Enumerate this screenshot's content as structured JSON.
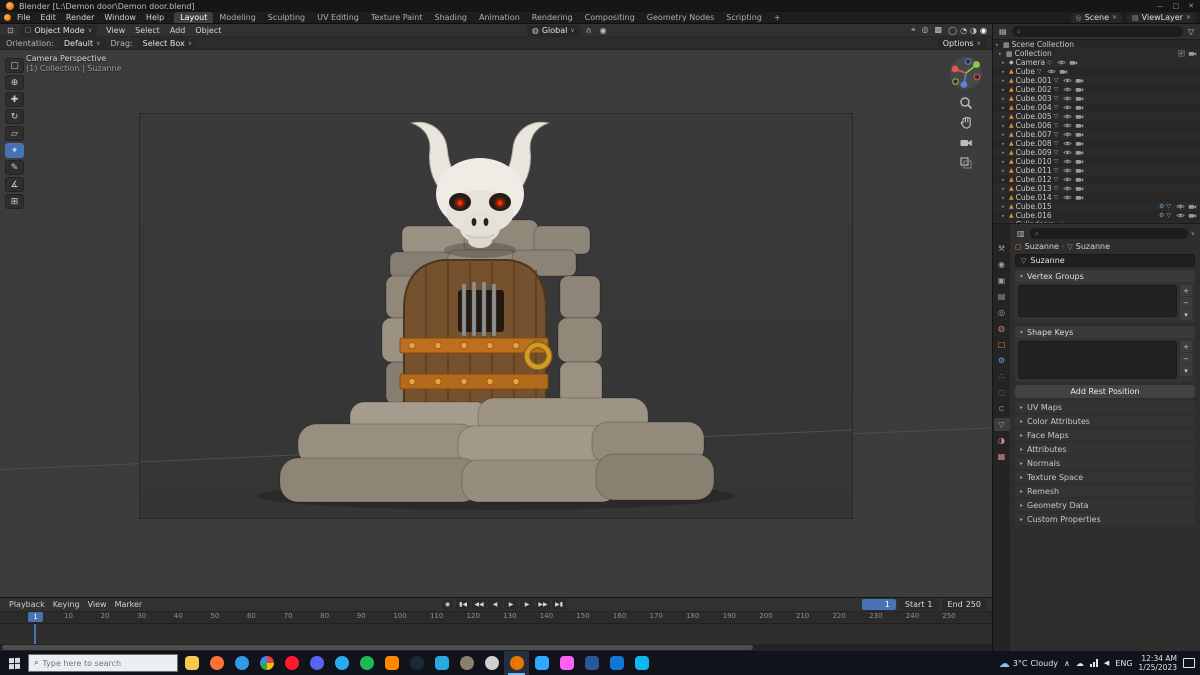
{
  "window": {
    "title": "Blender [L:\\Demon door\\Demon door.blend]",
    "controls": {
      "minimize": "—",
      "maximize": "□",
      "close": "✕"
    }
  },
  "topbar": {
    "menus": [
      "File",
      "Edit",
      "Render",
      "Window",
      "Help"
    ],
    "workspaces": [
      {
        "label": "Layout",
        "state": "active"
      },
      {
        "label": "Modeling",
        "state": ""
      },
      {
        "label": "Sculpting",
        "state": ""
      },
      {
        "label": "UV Editing",
        "state": ""
      },
      {
        "label": "Texture Paint",
        "state": ""
      },
      {
        "label": "Shading",
        "state": ""
      },
      {
        "label": "Animation",
        "state": ""
      },
      {
        "label": "Rendering",
        "state": ""
      },
      {
        "label": "Compositing",
        "state": ""
      },
      {
        "label": "Geometry Nodes",
        "state": ""
      },
      {
        "label": "Scripting",
        "state": ""
      }
    ],
    "add_workspace": "+",
    "scene_label": "Scene",
    "viewlayer_label": "ViewLayer"
  },
  "viewport": {
    "header": {
      "mode": "Object Mode",
      "menus": [
        "View",
        "Select",
        "Add",
        "Object"
      ],
      "orientation": "Global",
      "snap_icon": "∩",
      "proportional_icon": "◉",
      "right_icons": [
        {
          "name": "show-gizmo-icon",
          "glyph": "⌖"
        },
        {
          "name": "show-overlays-icon",
          "glyph": "◎"
        },
        {
          "name": "toggle-xray-icon",
          "glyph": "▩"
        }
      ],
      "shading_modes": [
        {
          "name": "shading-wireframe-icon",
          "glyph": "◯",
          "state": ""
        },
        {
          "name": "shading-solid-icon",
          "glyph": "◔",
          "state": ""
        },
        {
          "name": "shading-material-icon",
          "glyph": "◑",
          "state": ""
        },
        {
          "name": "shading-rendered-icon",
          "glyph": "◉",
          "state": "on"
        }
      ]
    },
    "tool_settings": {
      "orientation_label": "Orientation:",
      "orientation_value": "Default",
      "drag_label": "Drag:",
      "tool_value": "Select Box",
      "options_label": "Options"
    },
    "tools": [
      {
        "name": "tool-tweak-select",
        "glyph": "▢",
        "state": ""
      },
      {
        "name": "tool-cursor",
        "glyph": "⊕",
        "state": ""
      },
      {
        "name": "tool-move",
        "glyph": "✚",
        "state": ""
      },
      {
        "name": "tool-rotate",
        "glyph": "↻",
        "state": ""
      },
      {
        "name": "tool-scale",
        "glyph": "▱",
        "state": ""
      },
      {
        "name": "tool-transform",
        "glyph": "⌖",
        "state": "active"
      },
      {
        "name": "tool-annotate",
        "glyph": "✎",
        "state": ""
      },
      {
        "name": "tool-measure",
        "glyph": "∡",
        "state": ""
      },
      {
        "name": "tool-add-cube",
        "glyph": "⊞",
        "state": ""
      }
    ],
    "overlay": {
      "line1": "Camera Perspective",
      "line2": "(1) Collection | Suzanne"
    }
  },
  "outliner": {
    "caret": "▸",
    "root": "Scene Collection",
    "collection": "Collection",
    "items": [
      {
        "dname": "outliner-item-camera",
        "name": "Camera",
        "icon": "◆",
        "cls": "ico-cam",
        "data_icon": "◇",
        "extra": ""
      },
      {
        "dname": "outliner-item-cube",
        "name": "Cube",
        "icon": "▲",
        "cls": "ico-mesh",
        "data_icon": "▽",
        "extra": ""
      },
      {
        "dname": "outliner-item-cube-001",
        "name": "Cube.001",
        "icon": "▲",
        "cls": "ico-mesh",
        "data_icon": "▽",
        "extra": ""
      },
      {
        "dname": "outliner-item-cube-002",
        "name": "Cube.002",
        "icon": "▲",
        "cls": "ico-mesh",
        "data_icon": "▽",
        "extra": ""
      },
      {
        "dname": "outliner-item-cube-003",
        "name": "Cube.003",
        "icon": "▲",
        "cls": "ico-mesh",
        "data_icon": "▽",
        "extra": ""
      },
      {
        "dname": "outliner-item-cube-004",
        "name": "Cube.004",
        "icon": "▲",
        "cls": "ico-mesh",
        "data_icon": "▽",
        "extra": ""
      },
      {
        "dname": "outliner-item-cube-005",
        "name": "Cube.005",
        "icon": "▲",
        "cls": "ico-mesh",
        "data_icon": "▽",
        "extra": ""
      },
      {
        "dname": "outliner-item-cube-006",
        "name": "Cube.006",
        "icon": "▲",
        "cls": "ico-mesh",
        "data_icon": "▽",
        "extra": ""
      },
      {
        "dname": "outliner-item-cube-007",
        "name": "Cube.007",
        "icon": "▲",
        "cls": "ico-mesh",
        "data_icon": "▽",
        "extra": ""
      },
      {
        "dname": "outliner-item-cube-008",
        "name": "Cube.008",
        "icon": "▲",
        "cls": "ico-mesh",
        "data_icon": "▽",
        "extra": ""
      },
      {
        "dname": "outliner-item-cube-009",
        "name": "Cube.009",
        "icon": "▲",
        "cls": "ico-mesh",
        "data_icon": "▽",
        "extra": ""
      },
      {
        "dname": "outliner-item-cube-010",
        "name": "Cube.010",
        "icon": "▲",
        "cls": "ico-mesh",
        "data_icon": "▽",
        "extra": ""
      },
      {
        "dname": "outliner-item-cube-011",
        "name": "Cube.011",
        "icon": "▲",
        "cls": "ico-mesh",
        "data_icon": "▽",
        "extra": ""
      },
      {
        "dname": "outliner-item-cube-012",
        "name": "Cube.012",
        "icon": "▲",
        "cls": "ico-mesh",
        "data_icon": "▽",
        "extra": ""
      },
      {
        "dname": "outliner-item-cube-013",
        "name": "Cube.013",
        "icon": "▲",
        "cls": "ico-mesh",
        "data_icon": "▽",
        "extra": ""
      },
      {
        "dname": "outliner-item-cube-014",
        "name": "Cube.014",
        "icon": "▲",
        "cls": "ico-mesh",
        "data_icon": "▽",
        "extra": ""
      },
      {
        "dname": "outliner-item-cube-015",
        "name": "Cube.015",
        "icon": "▲",
        "cls": "ico-mesh",
        "data_icon": "▽",
        "extra": "⚙"
      },
      {
        "dname": "outliner-item-cube-016",
        "name": "Cube.016",
        "icon": "▲",
        "cls": "ico-mesh",
        "data_icon": "▽",
        "extra": "⚙"
      },
      {
        "dname": "outliner-item-cylinder",
        "name": "Cylinder",
        "icon": "▲",
        "cls": "ico-mesh",
        "data_icon": "▽",
        "extra": ""
      }
    ]
  },
  "properties": {
    "tabs": [
      {
        "name": "tab-tool-properties",
        "glyph": "⚒",
        "cls": "t-gray",
        "state": ""
      },
      {
        "name": "tab-render-properties",
        "glyph": "◉",
        "cls": "t-gray",
        "state": ""
      },
      {
        "name": "tab-output-properties",
        "glyph": "▣",
        "cls": "t-gray",
        "state": ""
      },
      {
        "name": "tab-view-layer-properties",
        "glyph": "▤",
        "cls": "t-gray",
        "state": ""
      },
      {
        "name": "tab-scene-properties",
        "glyph": "◎",
        "cls": "t-gray",
        "state": ""
      },
      {
        "name": "tab-world-properties",
        "glyph": "◍",
        "cls": "t-red",
        "state": ""
      },
      {
        "name": "tab-object-properties",
        "glyph": "□",
        "cls": "t-orange",
        "state": ""
      },
      {
        "name": "tab-modifier-properties",
        "glyph": "⚙",
        "cls": "t-blue",
        "state": ""
      },
      {
        "name": "tab-particle-properties",
        "glyph": "∴",
        "cls": "t-blue",
        "state": ""
      },
      {
        "name": "tab-physics-properties",
        "glyph": "◌",
        "cls": "t-blue",
        "state": ""
      },
      {
        "name": "tab-constraint-properties",
        "glyph": "⊂",
        "cls": "t-blue",
        "state": ""
      },
      {
        "name": "tab-object-data-properties",
        "glyph": "▽",
        "cls": "t-green",
        "state": "active"
      },
      {
        "name": "tab-material-properties",
        "glyph": "◑",
        "cls": "t-pink",
        "state": ""
      },
      {
        "name": "tab-texture-properties",
        "glyph": "▦",
        "cls": "t-pink",
        "state": ""
      }
    ],
    "breadcrumb": {
      "object": "Suzanne",
      "data": "Suzanne",
      "sep": "›"
    },
    "name_field": "Suzanne",
    "vertex_groups_label": "Vertex Groups",
    "shape_keys_label": "Shape Keys",
    "rest_button": "Add Rest Position",
    "list_buttons": {
      "add": "+",
      "remove": "−",
      "menu": "▾"
    },
    "collapsed_panels": [
      {
        "label": "UV Maps"
      },
      {
        "label": "Color Attributes"
      },
      {
        "label": "Face Maps"
      },
      {
        "label": "Attributes"
      },
      {
        "label": "Normals"
      },
      {
        "label": "Texture Space"
      },
      {
        "label": "Remesh"
      },
      {
        "label": "Geometry Data"
      },
      {
        "label": "Custom Properties"
      }
    ]
  },
  "timeline": {
    "menus": [
      "Playback",
      "Keying",
      "View",
      "Marker"
    ],
    "autokey_icon": "◉",
    "transport": [
      {
        "name": "jump-to-start-button",
        "glyph": "▮◀"
      },
      {
        "name": "prev-keyframe-button",
        "glyph": "◀◀"
      },
      {
        "name": "prev-frame-button",
        "glyph": "◀"
      },
      {
        "name": "play-button",
        "glyph": "▶"
      },
      {
        "name": "next-frame-button",
        "glyph": "▶"
      },
      {
        "name": "next-keyframe-button",
        "glyph": "▶▶"
      },
      {
        "name": "jump-to-end-button",
        "glyph": "▶▮"
      }
    ],
    "current_frame": "1",
    "start_label": "Start",
    "start_value": "1",
    "end_label": "End",
    "end_value": "250",
    "ruler": [
      "10",
      "20",
      "30",
      "40",
      "50",
      "60",
      "70",
      "80",
      "90",
      "100",
      "110",
      "120",
      "130",
      "140",
      "150",
      "160",
      "170",
      "180",
      "190",
      "200",
      "210",
      "220",
      "230",
      "240",
      "250"
    ]
  },
  "taskbar": {
    "search_placeholder": "Type here to search",
    "apps": [
      {
        "name": "taskbar-app-file-explorer",
        "style": "background:#f6c84c",
        "state": ""
      },
      {
        "name": "taskbar-app-firefox",
        "style": "background:#ff7139;border-radius:50%",
        "state": ""
      },
      {
        "name": "taskbar-app-edge",
        "style": "background:#2e9be6;border-radius:50%",
        "state": ""
      },
      {
        "name": "taskbar-app-chrome",
        "style": "background:conic-gradient(#ea4335 0 25%,#fbbc05 0 50%,#34a853 0 75%,#4285f4 0);border-radius:50%",
        "state": ""
      },
      {
        "name": "taskbar-app-opera",
        "style": "background:#ff1b2d;border-radius:50%",
        "state": ""
      },
      {
        "name": "taskbar-app-discord",
        "style": "background:#5865f2;border-radius:50%",
        "state": ""
      },
      {
        "name": "taskbar-app-telegram",
        "style": "background:#2aabee;border-radius:50%",
        "state": ""
      },
      {
        "name": "taskbar-app-spotify",
        "style": "background:#1db954;border-radius:50%",
        "state": ""
      },
      {
        "name": "taskbar-app-vlc",
        "style": "background:#ff8800",
        "state": ""
      },
      {
        "name": "taskbar-app-steam",
        "style": "background:#1b2838;border-radius:50%",
        "state": ""
      },
      {
        "name": "taskbar-app-vscode",
        "style": "background:#2aa9e0",
        "state": ""
      },
      {
        "name": "taskbar-app-gimp",
        "style": "background:#8a7f6d;border-radius:50%",
        "state": ""
      },
      {
        "name": "taskbar-app-unity",
        "style": "background:#d0d0d0;border-radius:50%",
        "state": ""
      },
      {
        "name": "taskbar-app-blender",
        "style": "background:#ea7600;border-radius:50%",
        "state": "active"
      },
      {
        "name": "taskbar-app-photoshop",
        "style": "background:#2daaff",
        "state": ""
      },
      {
        "name": "taskbar-app-xd",
        "style": "background:#ff61f6",
        "state": ""
      },
      {
        "name": "taskbar-app-word",
        "style": "background:#2b579a",
        "state": ""
      },
      {
        "name": "taskbar-app-mail",
        "style": "background:#0f78d4",
        "state": ""
      },
      {
        "name": "taskbar-app-store",
        "style": "background:#0fb5ee",
        "state": ""
      }
    ],
    "tray": {
      "weather_temp": "3°C",
      "weather_desc": "Cloudy",
      "chevron": "∧",
      "cloud_icon": "☁",
      "volume_icon": "◀",
      "lang": "ENG",
      "time": "12:34 AM",
      "date": "1/25/2023"
    }
  },
  "colors": {
    "accent_blue": "#4772b3",
    "blender_orange": "#ea7600",
    "mesh_icon_orange": "#e08c3c",
    "data_icon_green": "#6fc06f",
    "skull_white": "#efebe5",
    "eye_glow_red": "#ff2a00",
    "door_brown": "#75512e",
    "band_orange": "#bd6e1e",
    "stone_tan": "#9a9183"
  }
}
